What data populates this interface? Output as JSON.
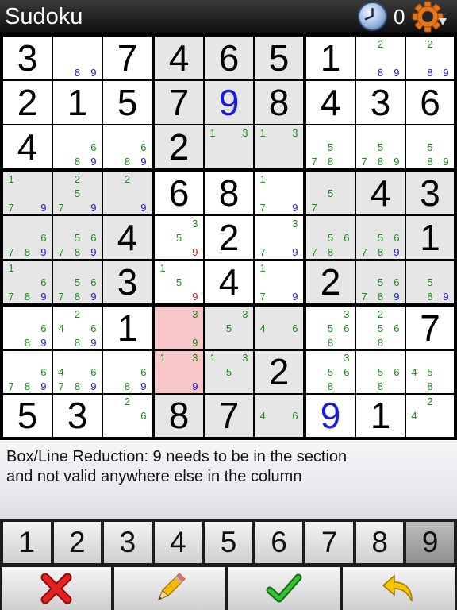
{
  "app": {
    "title": "Sudoku",
    "timer_count": "0"
  },
  "hint": {
    "line1": "Box/Line Reduction: 9 needs to be in the section",
    "line2": "and not valid anywhere else in the column"
  },
  "grid": [
    [
      {
        "v": "3"
      },
      {
        "pm": "89"
      },
      {
        "v": "7"
      },
      {
        "v": "4"
      },
      {
        "v": "6"
      },
      {
        "v": "5"
      },
      {
        "v": "1"
      },
      {
        "pm": "289"
      },
      {
        "pm": "289"
      }
    ],
    [
      {
        "v": "2"
      },
      {
        "v": "1"
      },
      {
        "v": "5"
      },
      {
        "v": "7"
      },
      {
        "v": "9",
        "user": true
      },
      {
        "v": "8"
      },
      {
        "v": "4"
      },
      {
        "v": "3"
      },
      {
        "v": "6"
      }
    ],
    [
      {
        "v": "4"
      },
      {
        "pm": "689"
      },
      {
        "pm": "689"
      },
      {
        "v": "2"
      },
      {
        "pm": "13"
      },
      {
        "pm": "13"
      },
      {
        "pm": "578"
      },
      {
        "pm": "5789"
      },
      {
        "pm": "589"
      }
    ],
    [
      {
        "pm": "179"
      },
      {
        "pm": "2579"
      },
      {
        "pm": "29"
      },
      {
        "v": "6"
      },
      {
        "v": "8"
      },
      {
        "pm": "179"
      },
      {
        "pm": "57"
      },
      {
        "v": "4"
      },
      {
        "v": "3"
      }
    ],
    [
      {
        "pm": "6789"
      },
      {
        "pm": "56789"
      },
      {
        "v": "4"
      },
      {
        "pm": "359"
      },
      {
        "v": "2"
      },
      {
        "pm": "379"
      },
      {
        "pm": "5678"
      },
      {
        "pm": "56789"
      },
      {
        "v": "1"
      }
    ],
    [
      {
        "pm": "16789"
      },
      {
        "pm": "56789"
      },
      {
        "v": "3"
      },
      {
        "pm": "159"
      },
      {
        "v": "4"
      },
      {
        "pm": "179"
      },
      {
        "v": "2"
      },
      {
        "pm": "56789"
      },
      {
        "pm": "589"
      }
    ],
    [
      {
        "pm": "689"
      },
      {
        "pm": "24689"
      },
      {
        "v": "1"
      },
      {
        "pm": "39"
      },
      {
        "pm": "35"
      },
      {
        "pm": "46"
      },
      {
        "pm": "3568"
      },
      {
        "pm": "2568"
      },
      {
        "v": "7"
      }
    ],
    [
      {
        "pm": "6789"
      },
      {
        "pm": "46789"
      },
      {
        "pm": "689"
      },
      {
        "pm": "139"
      },
      {
        "pm": "135"
      },
      {
        "v": "2"
      },
      {
        "pm": "3568"
      },
      {
        "pm": "568"
      },
      {
        "pm": "458"
      }
    ],
    [
      {
        "v": "5"
      },
      {
        "v": "3"
      },
      {
        "pm": "26"
      },
      {
        "v": "8"
      },
      {
        "v": "7"
      },
      {
        "pm": "46"
      },
      {
        "v": "9",
        "user": true
      },
      {
        "v": "1"
      },
      {
        "pm": "24"
      }
    ]
  ],
  "pencil_blue": [
    "0,1,8",
    "0,1,9",
    "0,7,8",
    "0,7,9",
    "0,8,8",
    "0,8,9",
    "2,1,9",
    "2,2,9",
    "3,0,9",
    "3,1,9",
    "3,2,9",
    "3,5,9",
    "4,0,9",
    "4,1,9",
    "4,5,9",
    "4,6,9",
    "4,7,9",
    "5,0,9",
    "5,1,9",
    "5,5,9",
    "5,7,9",
    "5,8,9",
    "6,0,9",
    "6,1,9",
    "7,0,9",
    "7,1,9",
    "7,2,9",
    "7,3,9",
    "3,0,9"
  ],
  "pencil_red": [
    "4,3,9",
    "5,3,9"
  ],
  "highlight_pink": [
    "6,3",
    "7,3"
  ],
  "highlight_gray_boxes": [
    1,
    3,
    5,
    7
  ],
  "numpad": {
    "keys": [
      "1",
      "2",
      "3",
      "4",
      "5",
      "6",
      "7",
      "8",
      "9"
    ],
    "selected": "9"
  },
  "actions": [
    {
      "name": "delete",
      "icon": "red-x-icon",
      "color": "#e01b1b"
    },
    {
      "name": "pencil",
      "icon": "pencil-icon",
      "color": "#f0b000"
    },
    {
      "name": "confirm",
      "icon": "green-check-icon",
      "color": "#22a822"
    },
    {
      "name": "undo",
      "icon": "undo-arrow-icon",
      "color": "#f4c200"
    }
  ],
  "colors": {
    "pencil_mark": "#1a8c1a",
    "user_digit": "#1a1adc",
    "conflict_mark": "#c81e1e",
    "highlight": "#f6c6c8"
  }
}
